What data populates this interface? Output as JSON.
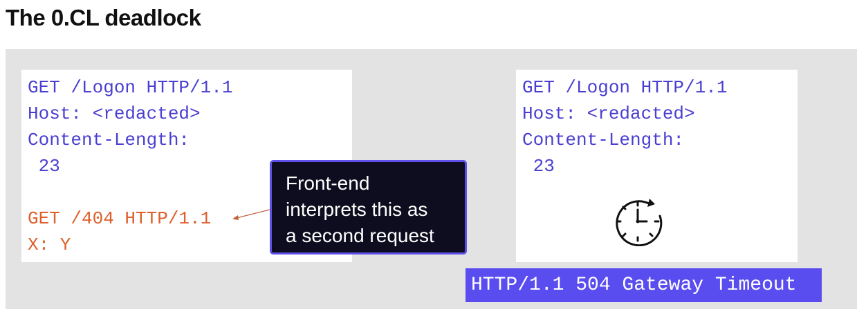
{
  "slide": {
    "title": "The 0.CL deadlock"
  },
  "left_request": {
    "line1": "GET /Logon HTTP/1.1",
    "line2": "Host: <redacted>",
    "line3": "Content-Length:",
    "line4": " 23",
    "smuggled_line1": "GET /404 HTTP/1.1",
    "smuggled_line2": "X: Y"
  },
  "callout": {
    "line1": "Front-end",
    "line2": "interprets this as",
    "line3": "a second request"
  },
  "right_request": {
    "line1": "GET /Logon HTTP/1.1",
    "line2": "Host: <redacted>",
    "line3": "Content-Length:",
    "line4": " 23",
    "icon": "clock-icon"
  },
  "response_badge": {
    "text": "HTTP/1.1 504 Gateway Timeout"
  },
  "colors": {
    "request_text": "#4a3fd0",
    "smuggled_text": "#dd5f2a",
    "callout_bg": "#0d0d1f",
    "callout_border": "#5e50e8",
    "badge_bg": "#5a4df0",
    "stage_bg": "#e3e3e3"
  }
}
